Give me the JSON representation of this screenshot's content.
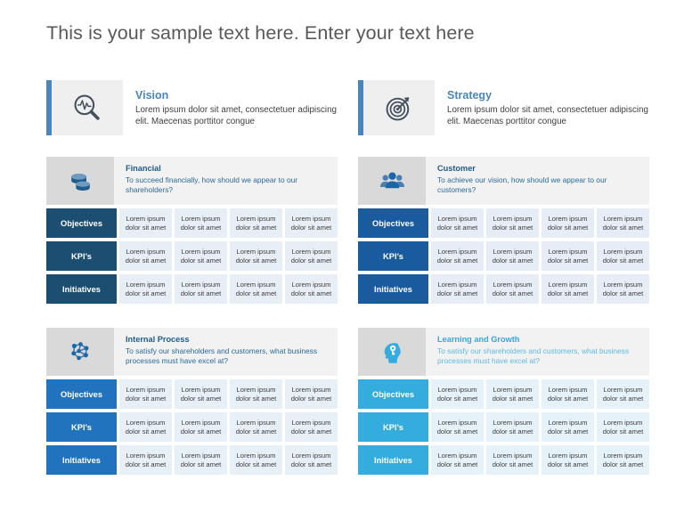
{
  "page": {
    "title": "This is your sample text here. Enter your text here"
  },
  "statements": [
    {
      "id": "vision",
      "title": "Vision",
      "description": "Lorem ipsum dolor sit amet, consectetuer adipiscing elit. Maecenas porttitor congue",
      "icon": "magnifier-pulse-icon",
      "accent": "#4a86b8"
    },
    {
      "id": "strategy",
      "title": "Strategy",
      "description": "Lorem ipsum dolor sit amet, consectetuer adipiscing elit. Maecenas porttitor congue",
      "icon": "target-arrow-icon",
      "accent": "#4a86b8"
    }
  ],
  "quadrants": [
    {
      "id": "financial",
      "title": "Financial",
      "question": "To succeed financially, how should we appear to our shareholders?",
      "icon": "coins-icon",
      "label_color": "#1c4e72",
      "cell_color": "#e8eef5",
      "title_color": "#1f5c8b",
      "rows": [
        {
          "label": "Objectives",
          "cells": [
            "Lorem ipsum dolor sit amet",
            "Lorem ipsum dolor sit amet",
            "Lorem ipsum dolor sit amet",
            "Lorem ipsum dolor sit amet"
          ]
        },
        {
          "label": "KPI’s",
          "cells": [
            "Lorem ipsum dolor sit amet",
            "Lorem ipsum dolor sit amet",
            "Lorem ipsum dolor sit amet",
            "Lorem ipsum dolor sit amet"
          ]
        },
        {
          "label": "Initiatives",
          "cells": [
            "Lorem ipsum dolor sit amet",
            "Lorem ipsum dolor sit amet",
            "Lorem ipsum dolor sit amet",
            "Lorem ipsum dolor sit amet"
          ]
        }
      ]
    },
    {
      "id": "customer",
      "title": "Customer",
      "question": "To achieve our vision, how should we appear to our customers?",
      "icon": "people-group-icon",
      "label_color": "#1a5ba0",
      "cell_color": "#e6edf6",
      "title_color": "#1f5c8b",
      "rows": [
        {
          "label": "Objectives",
          "cells": [
            "Lorem ipsum dolor sit amet",
            "Lorem ipsum dolor sit amet",
            "Lorem ipsum dolor sit amet",
            "Lorem ipsum dolor sit amet"
          ]
        },
        {
          "label": "KPI’s",
          "cells": [
            "Lorem ipsum dolor sit amet",
            "Lorem ipsum dolor sit amet",
            "Lorem ipsum dolor sit amet",
            "Lorem ipsum dolor sit amet"
          ]
        },
        {
          "label": "Initiatives",
          "cells": [
            "Lorem ipsum dolor sit amet",
            "Lorem ipsum dolor sit amet",
            "Lorem ipsum dolor sit amet",
            "Lorem ipsum dolor sit amet"
          ]
        }
      ]
    },
    {
      "id": "internal-process",
      "title": "Internal Process",
      "question": "To satisfy our shareholders and customers, what business processes must have excel at?",
      "icon": "network-nodes-icon",
      "label_color": "#2273bd",
      "cell_color": "#e7eff7",
      "title_color": "#1f5c8b",
      "rows": [
        {
          "label": "Objectives",
          "cells": [
            "Lorem ipsum dolor sit amet",
            "Lorem ipsum dolor sit amet",
            "Lorem ipsum dolor sit amet",
            "Lorem ipsum dolor sit amet"
          ]
        },
        {
          "label": "KPI’s",
          "cells": [
            "Lorem ipsum dolor sit amet",
            "Lorem ipsum dolor sit amet",
            "Lorem ipsum dolor sit amet",
            "Lorem ipsum dolor sit amet"
          ]
        },
        {
          "label": "Initiatives",
          "cells": [
            "Lorem ipsum dolor sit amet",
            "Lorem ipsum dolor sit amet",
            "Lorem ipsum dolor sit amet",
            "Lorem ipsum dolor sit amet"
          ]
        }
      ]
    },
    {
      "id": "learning-and-growth",
      "title": "Learning and Growth",
      "question": "To satisfy our shareholders and customers, what business processes must have excel at?",
      "icon": "head-idea-icon",
      "label_color": "#35acde",
      "cell_color": "#e6f2f9",
      "title_color": "#35a8dd",
      "rows": [
        {
          "label": "Objectives",
          "cells": [
            "Lorem ipsum dolor sit amet",
            "Lorem ipsum dolor sit amet",
            "Lorem ipsum dolor sit amet",
            "Lorem ipsum dolor sit amet"
          ]
        },
        {
          "label": "KPI’s",
          "cells": [
            "Lorem ipsum dolor sit amet",
            "Lorem ipsum dolor sit amet",
            "Lorem ipsum dolor sit amet",
            "Lorem ipsum dolor sit amet"
          ]
        },
        {
          "label": "Initiatives",
          "cells": [
            "Lorem ipsum dolor sit amet",
            "Lorem ipsum dolor sit amet",
            "Lorem ipsum dolor sit amet",
            "Lorem ipsum dolor sit amet"
          ]
        }
      ]
    }
  ]
}
